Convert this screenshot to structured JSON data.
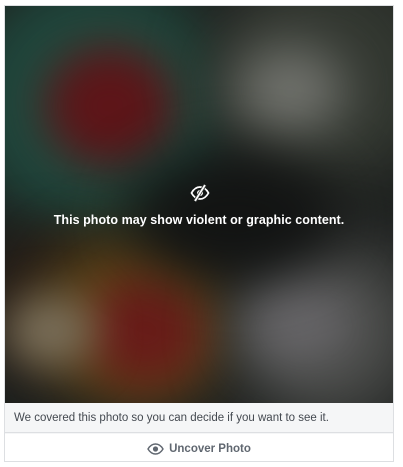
{
  "overlay": {
    "icon": "eye-slash-icon",
    "message": "This photo may show violent or graphic content."
  },
  "notice": {
    "text": "We covered this photo so you can decide if you want to see it."
  },
  "action": {
    "icon": "eye-icon",
    "label": "Uncover Photo"
  },
  "colors": {
    "card_border": "#dddfe2",
    "notice_background": "#f5f6f7",
    "text_secondary": "#606770"
  }
}
